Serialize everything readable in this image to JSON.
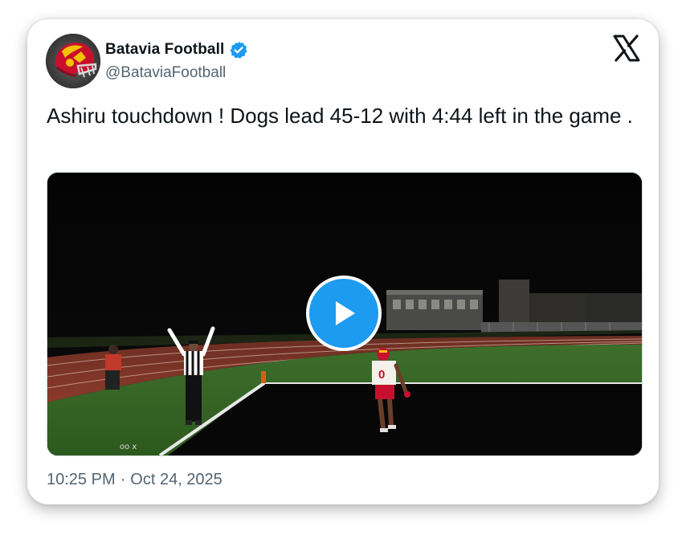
{
  "account": {
    "display_name": "Batavia Football",
    "handle": "@BataviaFootball",
    "verified": true,
    "avatar_icon": "football-helmet-avatar"
  },
  "tweet": {
    "text": "Ashiru touchdown ! Dogs lead 45-12 with 4:44 left in the game ."
  },
  "media": {
    "type": "video",
    "play_icon": "play-icon"
  },
  "meta": {
    "time": "10:25 PM",
    "separator": "·",
    "date": "Oct 24, 2025"
  },
  "colors": {
    "accent": "#1d9bf0",
    "text": "#0f1419",
    "secondary_text": "#536471"
  }
}
